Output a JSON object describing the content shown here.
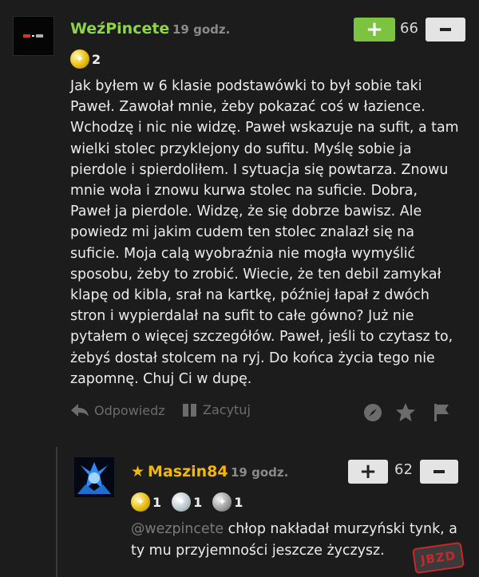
{
  "comment": {
    "username": "WeźPincete",
    "time": "19 godz.",
    "vote_plus_label": "+",
    "votes": "66",
    "badge_count": "2",
    "text": "Jak byłem w 6 klasie podstawówki to był sobie taki\nPaweł. Zawołał mnie, żeby pokazać coś w łazience.\nWchodzę i nic nie widzę. Paweł wskazuje na sufit, a tam\nwielki stolec przyklejony do sufitu. Myślę sobie ja\npierdole i spierdoliłem. I sytuacja się powtarza. Znowu\nmnie woła i znowu kurwa stolec na suficie. Dobra,\nPaweł ja pierdole. Widzę, że się dobrze bawisz. Ale\npowiedz mi jakim cudem ten stolec znalazł się na\nsuficie. Moja calą wyobraźnia nie mogła wymyślić\nsposobu, żeby to zrobić. Wiecie, że ten debil zamykał\nklapę od kibla, srał na kartkę, później łapał z dwóch\nstron i wypierdalał na sufit to całe gówno? Już nie\npytałem o więcej szczegółów. Paweł, jeśli to czytasz to,\nżebyś dostał stolcem na ryj. Do końca życia tego nie\nzapomnę. Chuj Ci w dupę.",
    "actions": {
      "reply": "Odpowiedz",
      "quote": "Zacytuj"
    }
  },
  "reply": {
    "username": "Maszin84",
    "time": "19 godz.",
    "vote_plus_label": "+",
    "votes": "62",
    "badges": [
      "1",
      "1",
      "1"
    ],
    "mention": "@wezpincete",
    "text": " chłop nakładał murzyński tynk, a ty mu przyjemności jeszcze życzysz."
  },
  "watermark": "JBZD",
  "colors": {
    "background": "#1c1c1c",
    "username_green": "#8fd44a",
    "username_gold": "#f5b800",
    "vote_plus_green": "#7cc341",
    "muted": "#6c6c6c"
  },
  "icons": [
    "reply-arrow-icon",
    "quote-icon",
    "compass-icon",
    "star-icon",
    "flag-icon",
    "medal-icon",
    "star-rank-icon"
  ]
}
